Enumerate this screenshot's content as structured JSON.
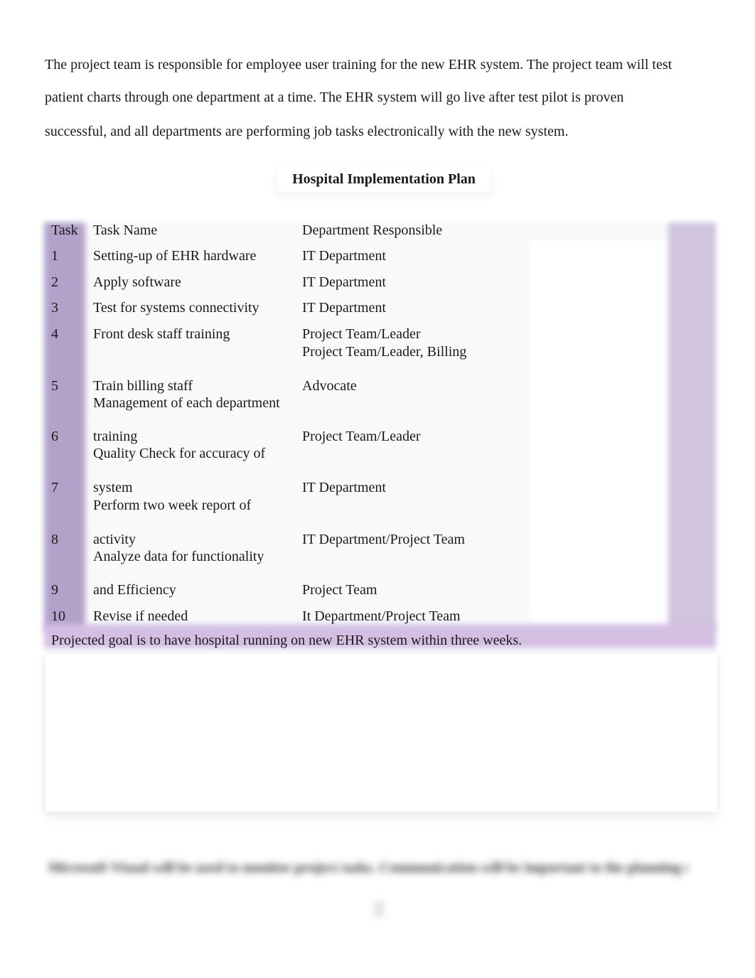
{
  "document": {
    "intro_lines": [
      "The project team is responsible for employee user training for the new EHR system. The project team will test",
      "patient charts through one department at a time. The EHR system will go live after test pilot is proven",
      "successful, and all departments are performing job tasks electronically with the new system."
    ],
    "table_title": "Hospital Implementation Plan",
    "table": {
      "headers": [
        "Task",
        "Task Name",
        "Department Responsible"
      ],
      "rows": [
        {
          "num": "1",
          "name": "Setting-up of EHR hardware",
          "dept": "IT Department"
        },
        {
          "num": "2",
          "name": "Apply software",
          "dept": "IT Department"
        },
        {
          "num": "3",
          "name": "Test for systems connectivity",
          "dept": "IT Department"
        },
        {
          "num": "4",
          "name": "Front desk staff training",
          "dept": "Project Team/Leader",
          "dept_extra": "Project Team/Leader, Billing"
        },
        {
          "num": "5",
          "name": "Train billing staff",
          "name_extra": "Management of each department",
          "dept": "Advocate"
        },
        {
          "num": "6",
          "name": "training",
          "name_extra": "Quality Check for accuracy of",
          "dept": "Project Team/Leader"
        },
        {
          "num": "7",
          "name": "system",
          "name_extra": "Perform two week report of",
          "dept": "IT Department"
        },
        {
          "num": "8",
          "name": "activity",
          "name_extra": "Analyze data for functionality",
          "dept": "IT Department/Project Team"
        },
        {
          "num": "9",
          "name": "and Efficiency",
          "dept": "Project Team"
        },
        {
          "num": "10",
          "name": "Revise if needed",
          "dept": "It Department/Project Team"
        }
      ],
      "footer_note": "Projected goal is to have hospital  running on new EHR system within three weeks."
    },
    "blurred_paragraph": "Microsoft Visual will be used to monitor project tasks.  Communication will be important to the planning so",
    "colors": {
      "left_column": "#b2a2c9",
      "right_column": "#d0c4de",
      "bottom_band": "#d4bfe3"
    }
  }
}
